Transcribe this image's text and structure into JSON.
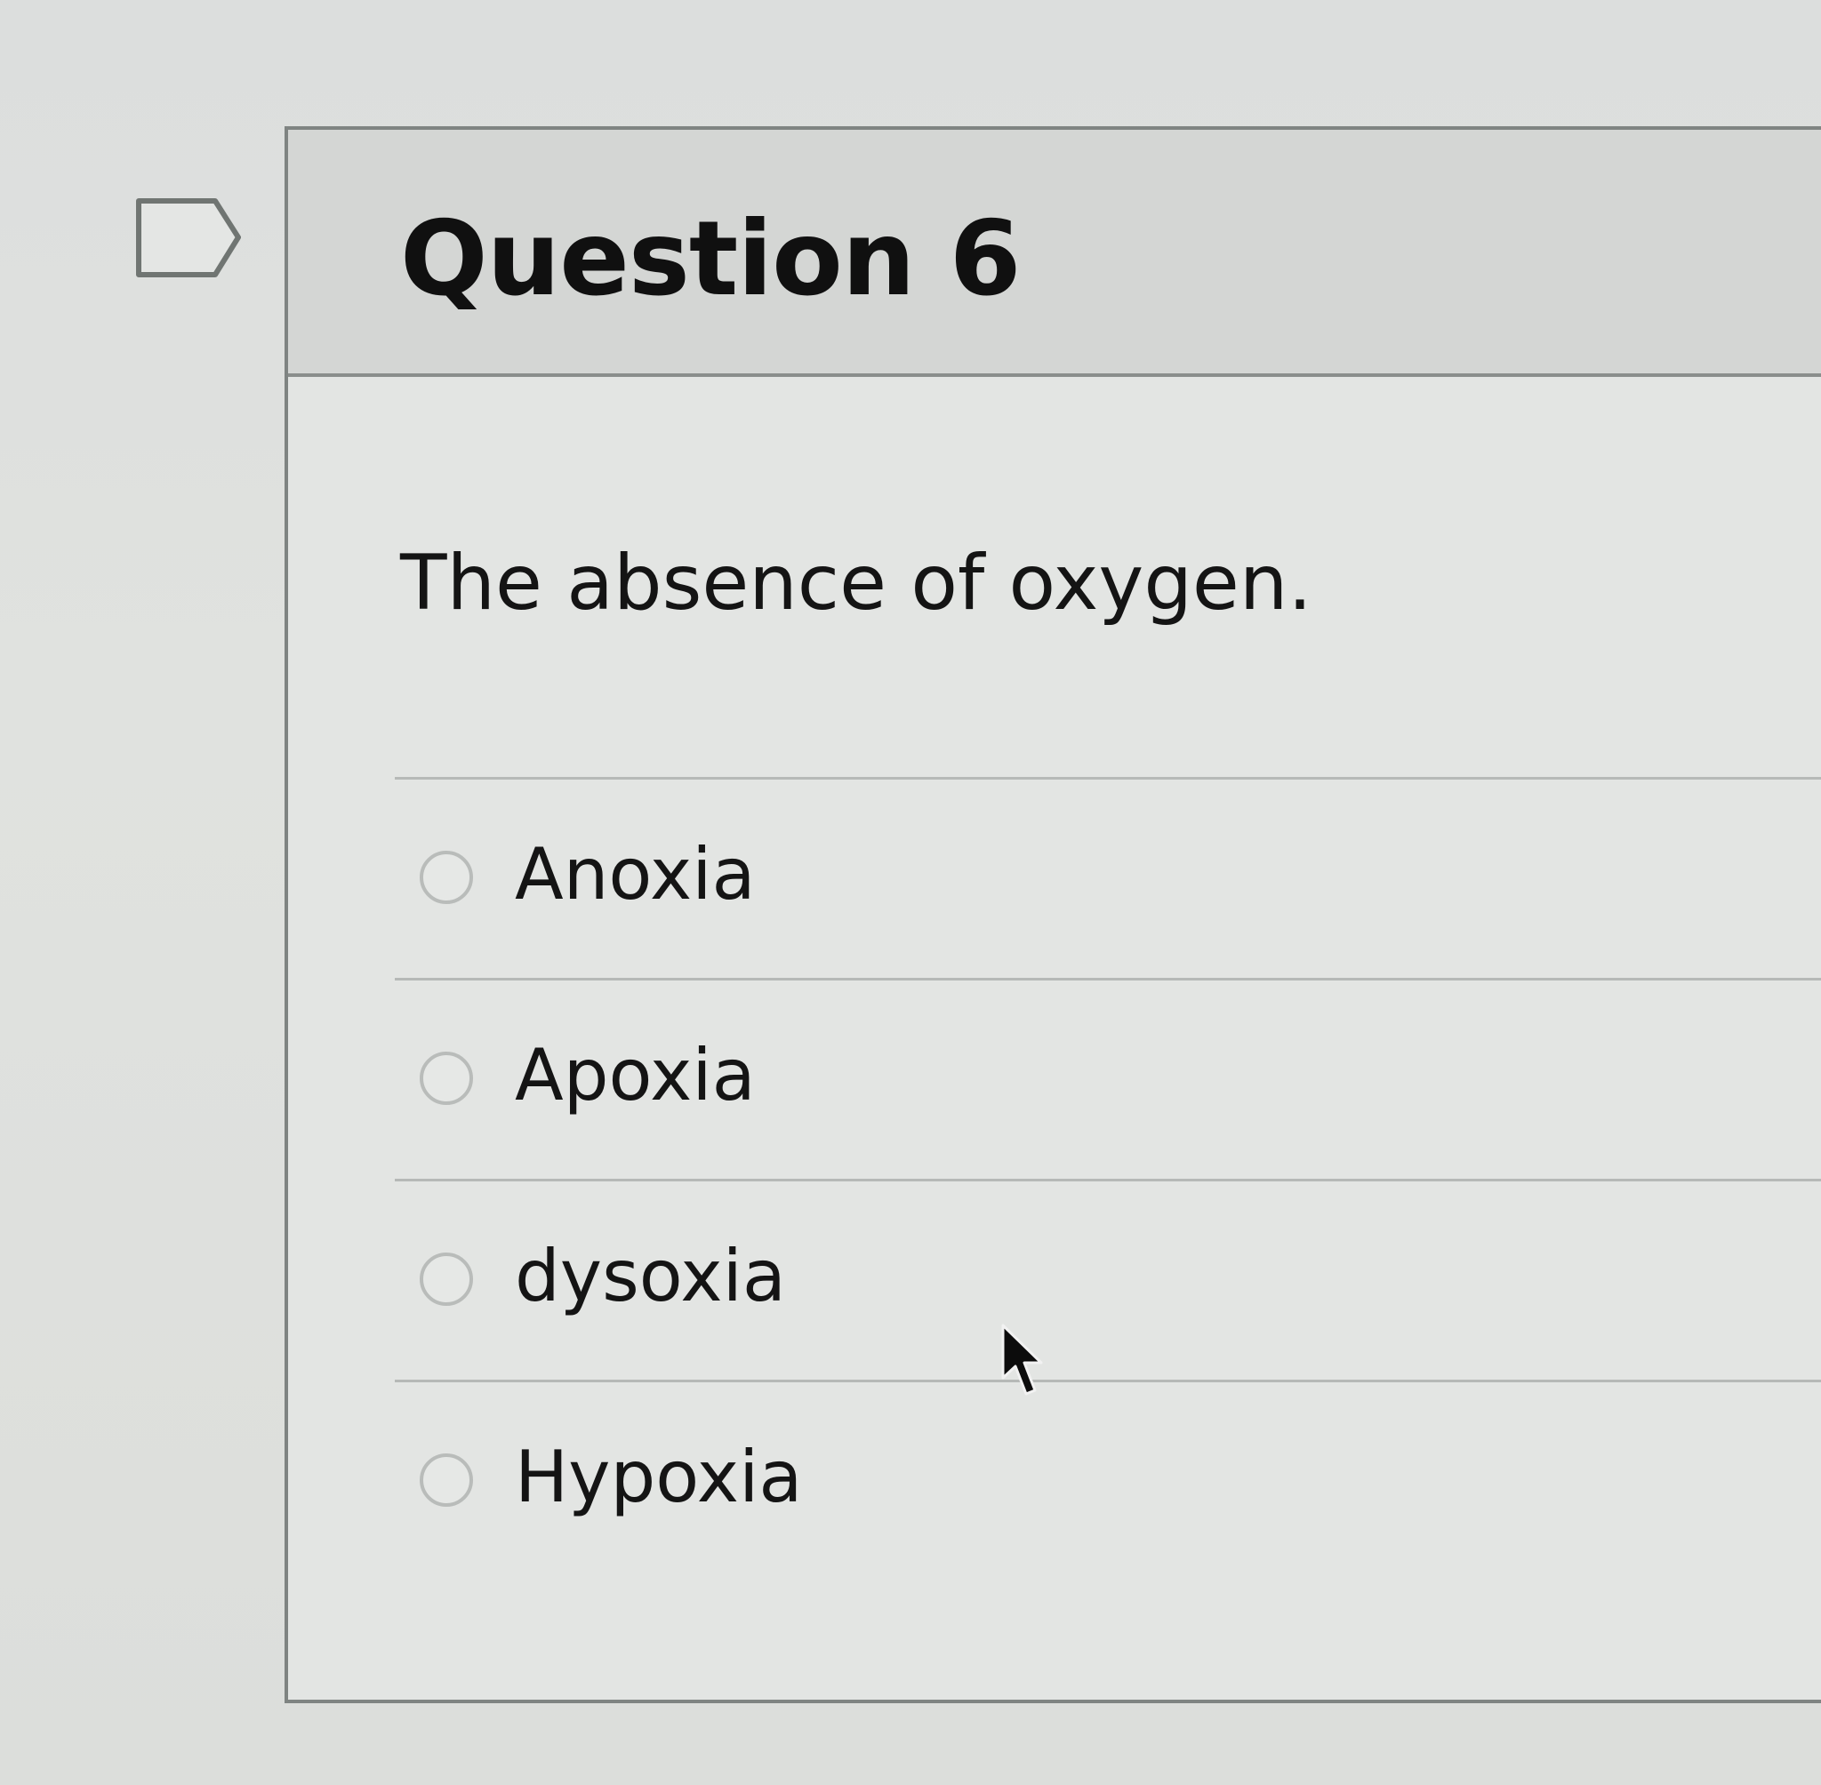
{
  "question": {
    "title": "Question 6",
    "prompt": "The absence of oxygen."
  },
  "answers": [
    {
      "label": "Anoxia",
      "selected": false
    },
    {
      "label": "Apoxia",
      "selected": false
    },
    {
      "label": "dysoxia",
      "selected": false
    },
    {
      "label": "Hypoxia",
      "selected": false
    }
  ],
  "icons": {
    "flag": "flag-question-icon",
    "cursor": "mouse-pointer-icon"
  },
  "colors": {
    "header_background": "#d4d6d4",
    "card_background": "#e3e5e3",
    "border": "#7f8482",
    "text": "#141414"
  }
}
